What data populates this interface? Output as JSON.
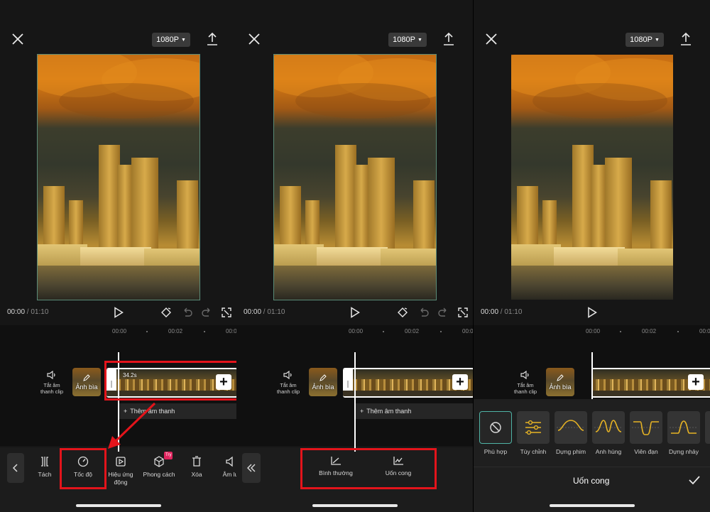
{
  "editor": {
    "resolution": "1080P",
    "time_current": "00:00",
    "time_sep": " / ",
    "time_total": "01:10",
    "ruler": [
      "00:00",
      "00:02",
      "00:0"
    ],
    "mute_label": "Tắt âm\nthanh clip",
    "cover_label": "Ảnh bìa",
    "clip_duration": "34.2s",
    "add_audio": "Thêm âm thanh"
  },
  "panel1": {
    "tools": [
      {
        "label": "Tách",
        "icon": "split-icon"
      },
      {
        "label": "Tốc độ",
        "icon": "speed-icon"
      },
      {
        "label": "Hiệu ứng\nđộng",
        "icon": "animation-icon"
      },
      {
        "label": "Phong cách",
        "icon": "style-cube-icon",
        "badge": "Try"
      },
      {
        "label": "Xóa",
        "icon": "trash-icon"
      },
      {
        "label": "Âm lư",
        "icon": "volume-icon"
      }
    ]
  },
  "panel2": {
    "speed_options": [
      {
        "label": "Bình thường",
        "icon": "normal-speed-icon"
      },
      {
        "label": "Uốn cong",
        "icon": "curve-speed-icon"
      }
    ]
  },
  "panel3": {
    "curves": [
      {
        "label": "Phù hợp",
        "icon": "none-icon"
      },
      {
        "label": "Tùy chỉnh",
        "icon": "custom-sliders-icon"
      },
      {
        "label": "Dựng phim",
        "icon": "montage-curve-icon"
      },
      {
        "label": "Anh hùng",
        "icon": "hero-curve-icon"
      },
      {
        "label": "Viên đạn",
        "icon": "bullet-curve-icon"
      },
      {
        "label": "Dựng nhảy",
        "icon": "jump-cut-curve-icon"
      }
    ],
    "title": "Uốn cong"
  },
  "colors": {
    "highlight": "#e3141b",
    "selected": "#4fb3a5",
    "accent_curve": "#e6b325"
  }
}
